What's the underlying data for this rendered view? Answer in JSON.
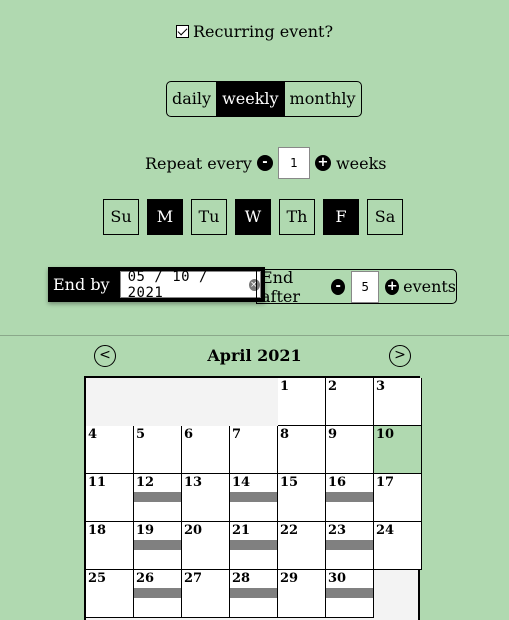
{
  "recurring": {
    "label": "Recurring event?",
    "checked": true
  },
  "frequency": {
    "options": [
      "daily",
      "weekly",
      "monthly"
    ],
    "selected": "weekly"
  },
  "repeat": {
    "prefix": "Repeat every",
    "value": "1",
    "unit": "weeks",
    "minus": "-",
    "plus": "+"
  },
  "days": [
    {
      "label": "Su",
      "selected": false
    },
    {
      "label": "M",
      "selected": true
    },
    {
      "label": "Tu",
      "selected": false
    },
    {
      "label": "W",
      "selected": true
    },
    {
      "label": "Th",
      "selected": false
    },
    {
      "label": "F",
      "selected": true
    },
    {
      "label": "Sa",
      "selected": false
    }
  ],
  "end_by": {
    "label": "End by",
    "date": "05 / 10 / 2021",
    "clear": "×"
  },
  "end_after": {
    "label": "End after",
    "value": "5",
    "unit": "events",
    "minus": "-",
    "plus": "+"
  },
  "calendar": {
    "month_label": "April 2021",
    "prev": "<",
    "next": ">",
    "leading_blanks": 4,
    "days_in_month": 30,
    "today": 10,
    "event_days": [
      12,
      14,
      16,
      19,
      21,
      23,
      26,
      28,
      30
    ],
    "colors": {
      "today": "#b0d9b0",
      "event": "#808080"
    }
  }
}
